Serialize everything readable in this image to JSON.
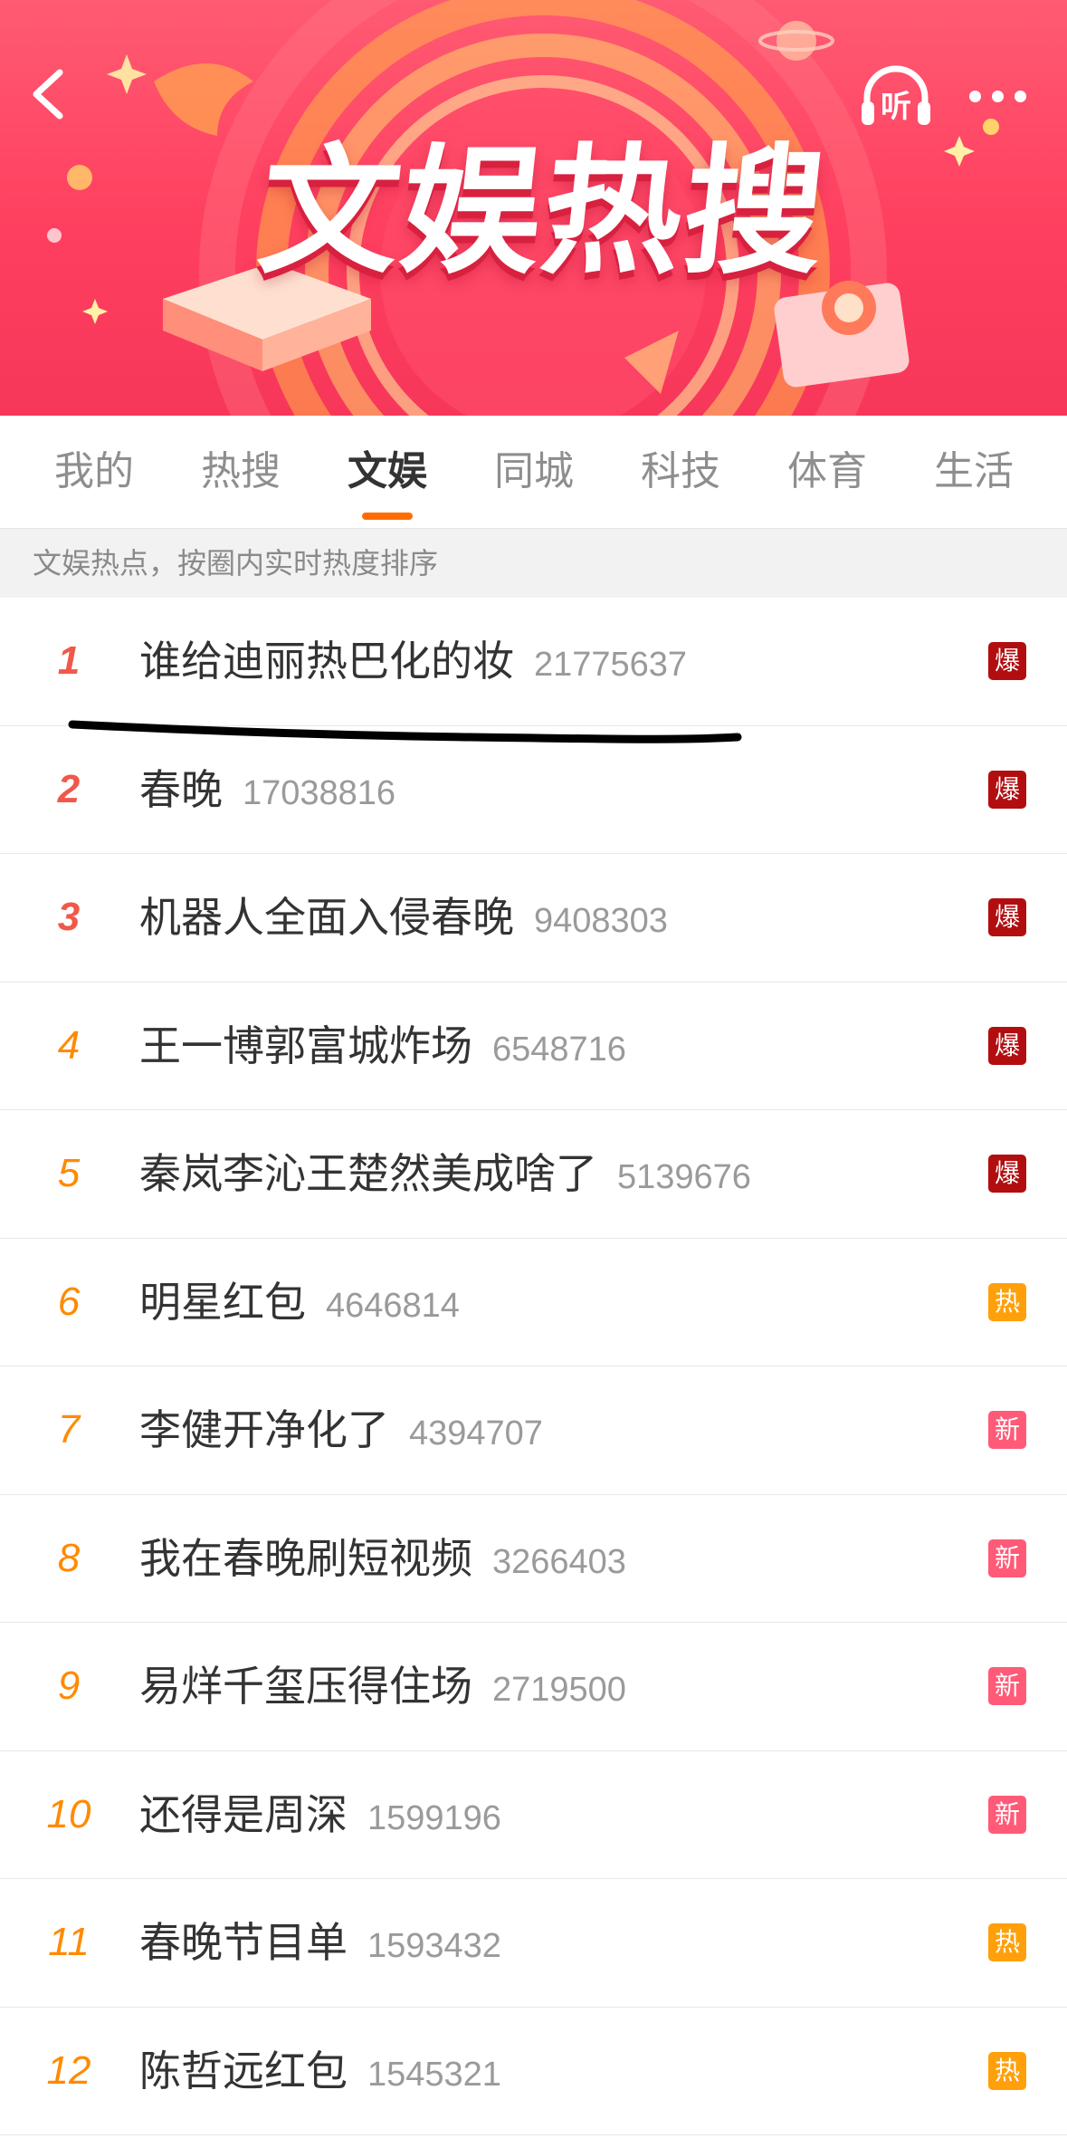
{
  "header": {
    "title": "文娱热搜",
    "listen_label": "听"
  },
  "tabs": [
    {
      "label": "我的",
      "active": false
    },
    {
      "label": "热搜",
      "active": false
    },
    {
      "label": "文娱",
      "active": true
    },
    {
      "label": "同城",
      "active": false
    },
    {
      "label": "科技",
      "active": false
    },
    {
      "label": "体育",
      "active": false
    },
    {
      "label": "生活",
      "active": false
    }
  ],
  "hint": "文娱热点，按圈内实时热度排序",
  "colors": {
    "rank_top": "#f1584a",
    "rank_other": "#ff8a00",
    "accent": "#ff6d00",
    "badge_bao": "#b20e10",
    "badge_re": "#ffa00a",
    "badge_xin": "#ff5a78"
  },
  "list": [
    {
      "rank": "1",
      "title": "谁给迪丽热巴化的妆",
      "count": "21775637",
      "badge": "爆"
    },
    {
      "rank": "2",
      "title": "春晚",
      "count": "17038816",
      "badge": "爆"
    },
    {
      "rank": "3",
      "title": "机器人全面入侵春晚",
      "count": "9408303",
      "badge": "爆"
    },
    {
      "rank": "4",
      "title": "王一博郭富城炸场",
      "count": "6548716",
      "badge": "爆"
    },
    {
      "rank": "5",
      "title": "秦岚李沁王楚然美成啥了",
      "count": "5139676",
      "badge": "爆"
    },
    {
      "rank": "6",
      "title": "明星红包",
      "count": "4646814",
      "badge": "热"
    },
    {
      "rank": "7",
      "title": "李健开净化了",
      "count": "4394707",
      "badge": "新"
    },
    {
      "rank": "8",
      "title": "我在春晚刷短视频",
      "count": "3266403",
      "badge": "新"
    },
    {
      "rank": "9",
      "title": "易烊千玺压得住场",
      "count": "2719500",
      "badge": "新"
    },
    {
      "rank": "10",
      "title": "还得是周深",
      "count": "1599196",
      "badge": "新"
    },
    {
      "rank": "11",
      "title": "春晚节目单",
      "count": "1593432",
      "badge": "热"
    },
    {
      "rank": "12",
      "title": "陈哲远红包",
      "count": "1545321",
      "badge": "热"
    }
  ]
}
